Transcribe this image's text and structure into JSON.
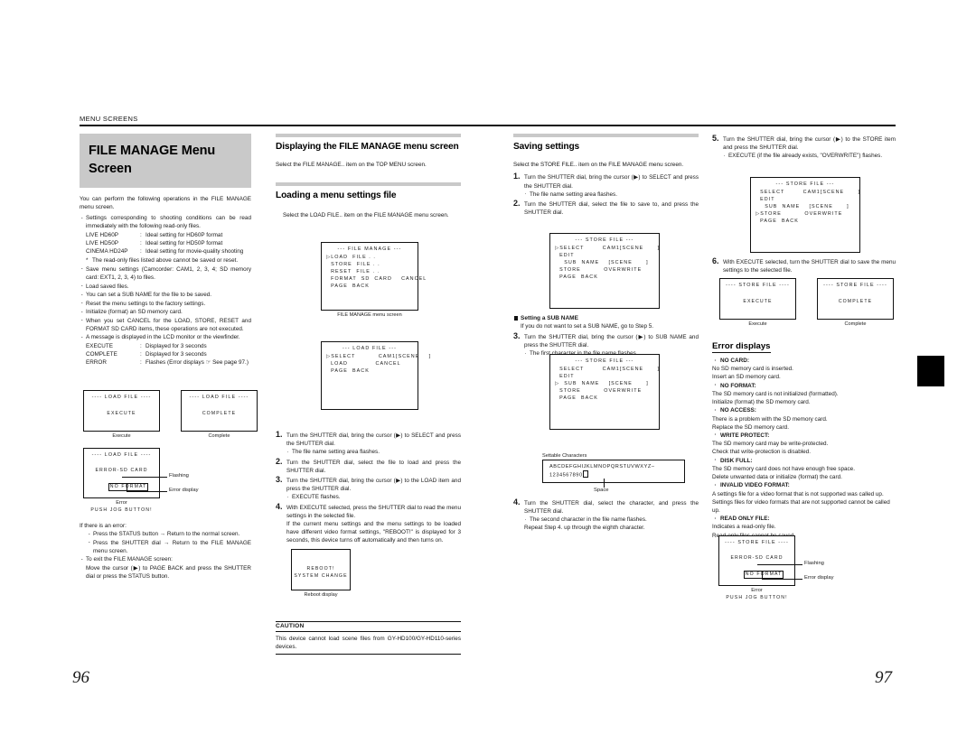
{
  "page": {
    "running_head": "MENU SCREENS",
    "left_page_number": "96",
    "right_page_number": "97"
  },
  "left_column": {
    "title": "FILE MANAGE Menu Screen",
    "intro": "You can perform the following operations in the FILE MANAGE menu screen.",
    "bullets": [
      "Settings corresponding to shooting conditions can be read immediately with the following read-only files.",
      "Save menu settings (Camcorder: CAM1, 2, 3, 4; SD memory card: EXT1, 2, 3, 4) to files.",
      "Load saved files.",
      "You can set a SUB NAME for the file to be saved.",
      "Reset the menu settings to the factory settings.",
      "Initialize (format) an SD memory card.",
      "When you set CANCEL for the LOAD, STORE, RESET and FORMAT SD CARD items, these operations are not executed.",
      "A message is displayed in the LCD monitor or the viewfinder."
    ],
    "readonly_files": [
      {
        "name": "LIVE HD60P",
        "desc": "Ideal setting for HD60P format"
      },
      {
        "name": "LIVE HD50P",
        "desc": "Ideal setting for HD50P format"
      },
      {
        "name": "CINEMA HD24P",
        "desc": "Ideal setting for movie-quality shooting"
      }
    ],
    "readonly_note": "The read-only files listed above cannot be saved or reset.",
    "messages": [
      {
        "name": "EXECUTE",
        "desc": "Displayed for 3 seconds"
      },
      {
        "name": "COMPLETE",
        "desc": "Displayed for 3 seconds"
      },
      {
        "name": "ERROR",
        "desc": "Flashes (Error displays ☞ See page 97.)"
      }
    ],
    "figures": {
      "execute": {
        "title": "---- LOAD FILE ----",
        "body": "EXECUTE",
        "caption": "Execute"
      },
      "complete": {
        "title": "---- LOAD FILE ----",
        "body": "COMPLETE",
        "caption": "Complete"
      },
      "error": {
        "title": "---- LOAD FILE ----",
        "line1": "ERROR-SD CARD",
        "line2": "NO FORMAT",
        "line3": "PUSH JOG BUTTON!",
        "caption": "Error",
        "callout_flashing": "Flashing",
        "callout_error": "Error display"
      }
    },
    "error_help": {
      "heading": "If there is an error:",
      "items": [
        "Press the STATUS button → Return to the normal screen.",
        "Press the SHUTTER dial → Return to the FILE MANAGE menu screen."
      ],
      "exit_bullet": "To exit the FILE MANAGE screen:",
      "exit_text": "Move the cursor (▶) to PAGE BACK and press the SHUTTER dial or press the STATUS button."
    }
  },
  "column2": {
    "heading_display": "Displaying the FILE MANAGE menu screen",
    "display_text": "Select the FILE MANAGE.. item on the TOP MENU screen.",
    "heading_loading": "Loading a menu settings file",
    "loading_text": "Select the LOAD FILE.. item on the FILE MANAGE menu screen.",
    "file_manage_screen": {
      "title": "--- FILE MANAGE ---",
      "lines": [
        "▷LOAD  FILE . .",
        "  STORE  FILE . .",
        "  RESET  FILE . .",
        "  FORMAT  SD  CARD    CANCEL",
        "  PAGE  BACK"
      ],
      "caption": "FILE MANAGE menu screen"
    },
    "load_file_screen": {
      "title": "--- LOAD FILE ---",
      "lines": [
        "▷SELECT          CAM1[SCENE    ]",
        "  LOAD            CANCEL",
        "  PAGE  BACK"
      ]
    },
    "steps": [
      {
        "num": "1.",
        "text": "Turn the SHUTTER dial, bring the cursor (▶) to SELECT and press the SHUTTER dial.",
        "sub": "The file name setting area flashes."
      },
      {
        "num": "2.",
        "text": "Turn the SHUTTER dial, select the file to load and press the SHUTTER dial.",
        "sub": ""
      },
      {
        "num": "3.",
        "text": "Turn the SHUTTER dial, bring the cursor (▶) to the LOAD item and press the SHUTTER dial.",
        "sub": "EXECUTE flashes."
      },
      {
        "num": "4.",
        "text": "With EXECUTE selected, press the SHUTTER dial to read the menu settings in the selected file.",
        "cont": "If the current menu settings and the menu settings to be loaded have different video format settings, \"REBOOT!\" is displayed for 3 seconds, this device turns off automatically and then turns on."
      }
    ],
    "reboot_figure": {
      "line1": "REBOOT!",
      "line2": "SYSTEM CHANGE",
      "caption": "Reboot display"
    },
    "caution": {
      "label": "CAUTION",
      "text": "This device cannot load scene files from GY-HD100/GY-HD110-series devices."
    }
  },
  "column3": {
    "heading_saving": "Saving settings",
    "saving_text": "Select the STORE FILE.. item on the FILE MANAGE menu screen.",
    "steps": [
      {
        "num": "1.",
        "text": "Turn the SHUTTER dial, bring the cursor (▶) to SELECT and press the SHUTTER dial.",
        "sub": "The file name setting area flashes."
      },
      {
        "num": "2.",
        "text": "Turn the SHUTTER dial, select the file to save to, and press the SHUTTER dial.",
        "sub": ""
      }
    ],
    "store_file_screen_1": {
      "title": "--- STORE FILE ---",
      "lines": [
        "▷SELECT        CAM1[SCENE      ]",
        "  EDIT",
        "    SUB  NAME    [SCENE      ]",
        "  STORE          OVERWRITE",
        "  PAGE  BACK"
      ]
    },
    "subname_heading": "Setting a SUB NAME",
    "subname_note": "If you do not want to set a SUB NAME, go to Step 5.",
    "step3": {
      "num": "3.",
      "text": "Turn the SHUTTER dial, bring the cursor (▶) to SUB NAME and press the SHUTTER dial.",
      "sub": "The first character in the file name flashes."
    },
    "store_file_screen_2": {
      "title": "--- STORE FILE ---",
      "lines": [
        "  SELECT        CAM1[SCENE      ]",
        "  EDIT",
        "▷  SUB  NAME    [SCENE      ]",
        "  STORE          OVERWRITE",
        "  PAGE  BACK"
      ]
    },
    "settable_characters": {
      "label": "Settable Characters",
      "line1": "ABCDEFGHIJKLMNOPQRSTUVWXYZ–",
      "line2": "1234567890",
      "space_caption": "Space"
    },
    "step4": {
      "num": "4.",
      "text": "Turn the SHUTTER dial, select the character, and press the SHUTTER dial.",
      "sub": "The second character in the file name flashes.",
      "cont": "Repeat Step 4. up through the eighth character."
    }
  },
  "column4": {
    "step5": {
      "num": "5.",
      "text": "Turn the SHUTTER dial, bring the cursor (▶) to the STORE item and press the SHUTTER dial.",
      "sub": "EXECUTE (if the file already exists, \"OVERWRITE\") flashes."
    },
    "store_file_screen_3": {
      "title": "--- STORE FILE ---",
      "lines": [
        "  SELECT        CAM1[SCENE      ]",
        "  EDIT",
        "    SUB  NAME    [SCENE      ]",
        "▷STORE          OVERWRITE",
        "  PAGE  BACK"
      ]
    },
    "step6": {
      "num": "6.",
      "text": "With EXECUTE selected, turn the SHUTTER dial to save the menu settings to the selected file."
    },
    "figures": {
      "execute": {
        "title": "---- STORE FILE ----",
        "body": "EXECUTE",
        "caption": "Execute"
      },
      "complete": {
        "title": "---- STORE FILE ----",
        "body": "COMPLETE",
        "caption": "Complete"
      },
      "error": {
        "title": "---- STORE FILE ----",
        "line1": "ERROR-SD CARD",
        "line2": "NO FORMAT",
        "line3": "PUSH JOG BUTTON!",
        "caption": "Error",
        "callout_flashing": "Flashing",
        "callout_error": "Error display"
      }
    },
    "error_displays_heading": "Error displays",
    "errors": [
      {
        "label": "NO CARD:",
        "lines": [
          "No SD memory card is inserted.",
          "Insert an SD memory card."
        ]
      },
      {
        "label": "NO FORMAT:",
        "lines": [
          "The SD memory card is not initialized (formatted).",
          "Initialize (format) the SD memory card."
        ]
      },
      {
        "label": "NO ACCESS:",
        "lines": [
          "There is a problem with the SD memory card.",
          "Replace the SD memory card."
        ]
      },
      {
        "label": "WRITE PROTECT:",
        "lines": [
          "The SD memory card may be write-protected.",
          "Check that write-protection is disabled."
        ]
      },
      {
        "label": "DISK FULL:",
        "lines": [
          "The SD memory card does not have enough free space.",
          "Delete unwanted data or initialize (format) the card."
        ]
      },
      {
        "label": "INVALID VIDEO FORMAT:",
        "lines": [
          "A settings file for a video format that is not supported was called up.",
          "Settings files for video formats that are not supported cannot be called up."
        ]
      },
      {
        "label": "READ ONLY FILE:",
        "lines": [
          "Indicates a read-only file.",
          "Read-only files cannot be saved."
        ]
      }
    ]
  },
  "colors": {
    "title_band": "#c9c9c9",
    "rule": "#111111",
    "text": "#1a1a1a"
  }
}
